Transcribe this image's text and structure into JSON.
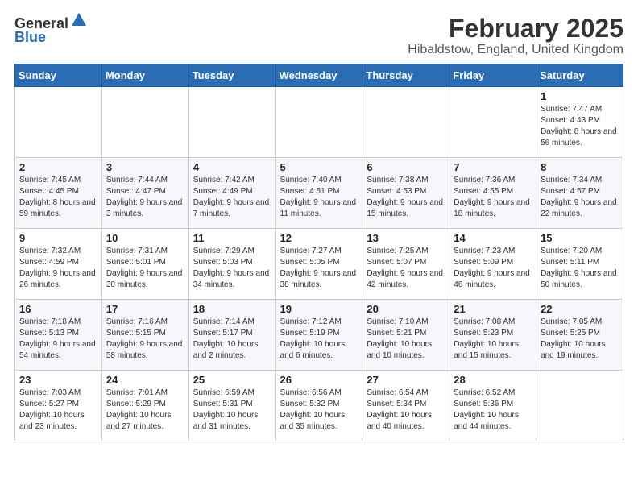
{
  "header": {
    "logo_general": "General",
    "logo_blue": "Blue",
    "title": "February 2025",
    "subtitle": "Hibaldstow, England, United Kingdom"
  },
  "days_of_week": [
    "Sunday",
    "Monday",
    "Tuesday",
    "Wednesday",
    "Thursday",
    "Friday",
    "Saturday"
  ],
  "weeks": [
    [
      {
        "day": "",
        "info": ""
      },
      {
        "day": "",
        "info": ""
      },
      {
        "day": "",
        "info": ""
      },
      {
        "day": "",
        "info": ""
      },
      {
        "day": "",
        "info": ""
      },
      {
        "day": "",
        "info": ""
      },
      {
        "day": "1",
        "info": "Sunrise: 7:47 AM\nSunset: 4:43 PM\nDaylight: 8 hours and 56 minutes."
      }
    ],
    [
      {
        "day": "2",
        "info": "Sunrise: 7:45 AM\nSunset: 4:45 PM\nDaylight: 8 hours and 59 minutes."
      },
      {
        "day": "3",
        "info": "Sunrise: 7:44 AM\nSunset: 4:47 PM\nDaylight: 9 hours and 3 minutes."
      },
      {
        "day": "4",
        "info": "Sunrise: 7:42 AM\nSunset: 4:49 PM\nDaylight: 9 hours and 7 minutes."
      },
      {
        "day": "5",
        "info": "Sunrise: 7:40 AM\nSunset: 4:51 PM\nDaylight: 9 hours and 11 minutes."
      },
      {
        "day": "6",
        "info": "Sunrise: 7:38 AM\nSunset: 4:53 PM\nDaylight: 9 hours and 15 minutes."
      },
      {
        "day": "7",
        "info": "Sunrise: 7:36 AM\nSunset: 4:55 PM\nDaylight: 9 hours and 18 minutes."
      },
      {
        "day": "8",
        "info": "Sunrise: 7:34 AM\nSunset: 4:57 PM\nDaylight: 9 hours and 22 minutes."
      }
    ],
    [
      {
        "day": "9",
        "info": "Sunrise: 7:32 AM\nSunset: 4:59 PM\nDaylight: 9 hours and 26 minutes."
      },
      {
        "day": "10",
        "info": "Sunrise: 7:31 AM\nSunset: 5:01 PM\nDaylight: 9 hours and 30 minutes."
      },
      {
        "day": "11",
        "info": "Sunrise: 7:29 AM\nSunset: 5:03 PM\nDaylight: 9 hours and 34 minutes."
      },
      {
        "day": "12",
        "info": "Sunrise: 7:27 AM\nSunset: 5:05 PM\nDaylight: 9 hours and 38 minutes."
      },
      {
        "day": "13",
        "info": "Sunrise: 7:25 AM\nSunset: 5:07 PM\nDaylight: 9 hours and 42 minutes."
      },
      {
        "day": "14",
        "info": "Sunrise: 7:23 AM\nSunset: 5:09 PM\nDaylight: 9 hours and 46 minutes."
      },
      {
        "day": "15",
        "info": "Sunrise: 7:20 AM\nSunset: 5:11 PM\nDaylight: 9 hours and 50 minutes."
      }
    ],
    [
      {
        "day": "16",
        "info": "Sunrise: 7:18 AM\nSunset: 5:13 PM\nDaylight: 9 hours and 54 minutes."
      },
      {
        "day": "17",
        "info": "Sunrise: 7:16 AM\nSunset: 5:15 PM\nDaylight: 9 hours and 58 minutes."
      },
      {
        "day": "18",
        "info": "Sunrise: 7:14 AM\nSunset: 5:17 PM\nDaylight: 10 hours and 2 minutes."
      },
      {
        "day": "19",
        "info": "Sunrise: 7:12 AM\nSunset: 5:19 PM\nDaylight: 10 hours and 6 minutes."
      },
      {
        "day": "20",
        "info": "Sunrise: 7:10 AM\nSunset: 5:21 PM\nDaylight: 10 hours and 10 minutes."
      },
      {
        "day": "21",
        "info": "Sunrise: 7:08 AM\nSunset: 5:23 PM\nDaylight: 10 hours and 15 minutes."
      },
      {
        "day": "22",
        "info": "Sunrise: 7:05 AM\nSunset: 5:25 PM\nDaylight: 10 hours and 19 minutes."
      }
    ],
    [
      {
        "day": "23",
        "info": "Sunrise: 7:03 AM\nSunset: 5:27 PM\nDaylight: 10 hours and 23 minutes."
      },
      {
        "day": "24",
        "info": "Sunrise: 7:01 AM\nSunset: 5:29 PM\nDaylight: 10 hours and 27 minutes."
      },
      {
        "day": "25",
        "info": "Sunrise: 6:59 AM\nSunset: 5:31 PM\nDaylight: 10 hours and 31 minutes."
      },
      {
        "day": "26",
        "info": "Sunrise: 6:56 AM\nSunset: 5:32 PM\nDaylight: 10 hours and 35 minutes."
      },
      {
        "day": "27",
        "info": "Sunrise: 6:54 AM\nSunset: 5:34 PM\nDaylight: 10 hours and 40 minutes."
      },
      {
        "day": "28",
        "info": "Sunrise: 6:52 AM\nSunset: 5:36 PM\nDaylight: 10 hours and 44 minutes."
      },
      {
        "day": "",
        "info": ""
      }
    ]
  ]
}
